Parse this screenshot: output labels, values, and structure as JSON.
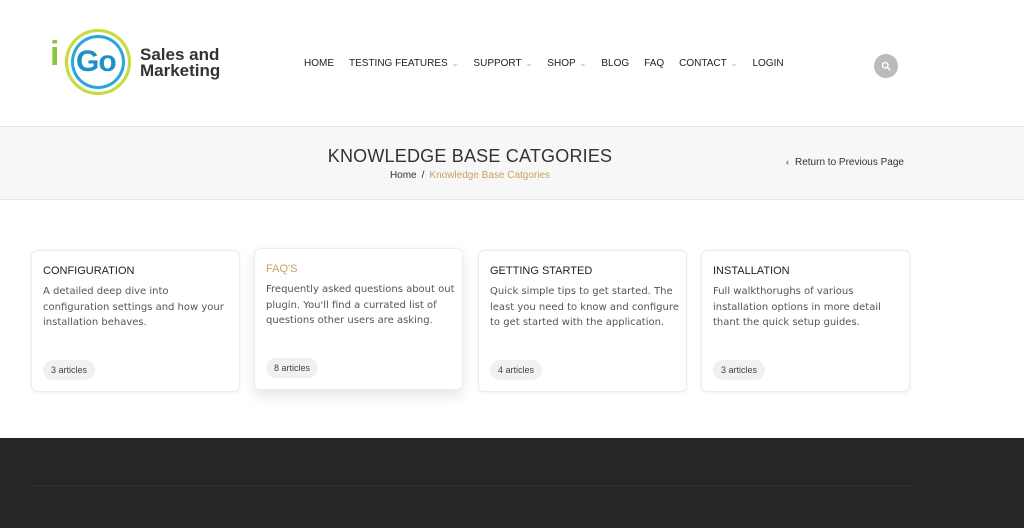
{
  "logo": {
    "mark_i": "i",
    "mark_go": "Go",
    "line1": "Sales and",
    "line2": "Marketing"
  },
  "nav": {
    "items": [
      {
        "label": "HOME",
        "dropdown": false
      },
      {
        "label": "TESTING FEATURES",
        "dropdown": true
      },
      {
        "label": "SUPPORT",
        "dropdown": true
      },
      {
        "label": "SHOP",
        "dropdown": true
      },
      {
        "label": "BLOG",
        "dropdown": false
      },
      {
        "label": "FAQ",
        "dropdown": false
      },
      {
        "label": "CONTACT",
        "dropdown": true
      },
      {
        "label": "LOGIN",
        "dropdown": false
      }
    ],
    "search_icon": "search-icon"
  },
  "titlebar": {
    "title": "KNOWLEDGE BASE CATGORIES",
    "breadcrumb_home": "Home",
    "breadcrumb_sep": "/",
    "breadcrumb_current": "Knowledge Base Catgories",
    "return_arrow": "‹",
    "return_label": "Return to Previous Page"
  },
  "cards": [
    {
      "title": "CONFIGURATION",
      "description": "A detailed deep dive into configuration settings and how your installation behaves.",
      "count": "3 articles",
      "accent": false
    },
    {
      "title": "FAQ'S",
      "description": "Frequently asked questions about out plugin. You'll find a currated list of questions other users are asking.",
      "count": "8 articles",
      "accent": true
    },
    {
      "title": "GETTING STARTED",
      "description": "Quick simple tips to get started. The least you need to know and configure to get started with the application.",
      "count": "4 articles",
      "accent": false
    },
    {
      "title": "INSTALLATION",
      "description": "Full walkthorughs of various installation options in more detail thant the quick setup guides.",
      "count": "3 articles",
      "accent": false
    }
  ],
  "colors": {
    "accent": "#c8a262",
    "footer": "#262626",
    "titlebar": "#f7f7f7"
  }
}
